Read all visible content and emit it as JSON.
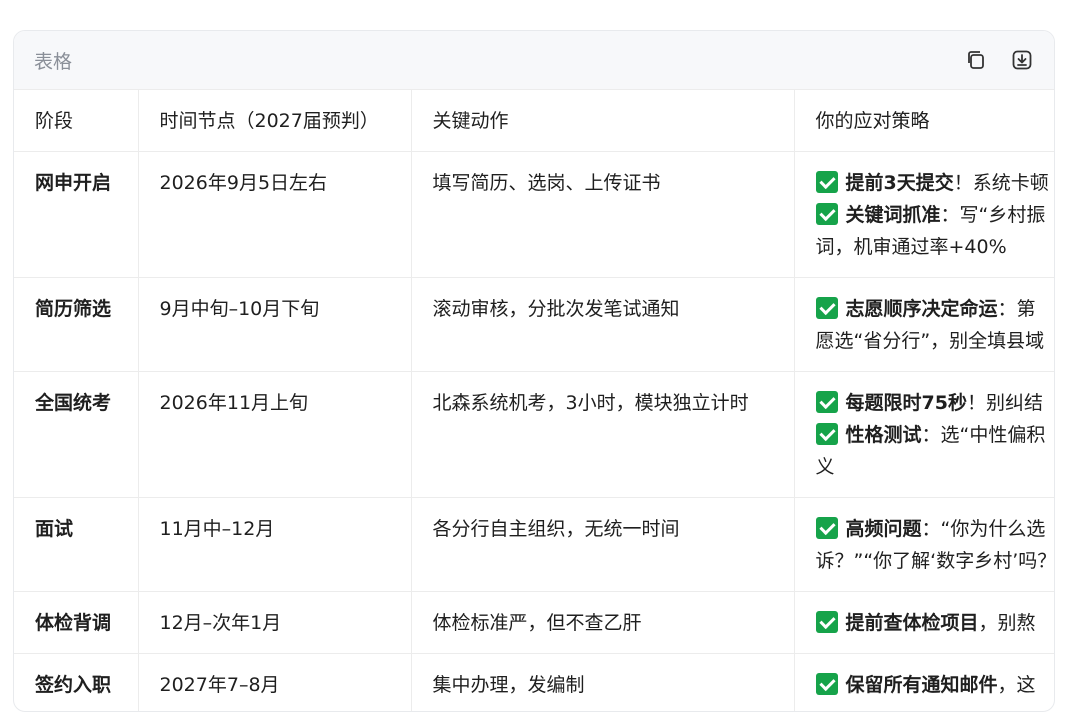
{
  "header": {
    "title": "表格"
  },
  "icons": {
    "copy": "copy-icon",
    "download": "download-icon"
  },
  "columns": [
    "阶段",
    "时间节点（2027届预判）",
    "关键动作",
    "你的应对策略"
  ],
  "rows": [
    {
      "stage": "网申开启",
      "time": "2026年9月5日左右",
      "action": "填写简历、选岗、上传证书",
      "strategy": [
        {
          "check": true,
          "bold": "提前3天提交",
          "rest": "！系统卡顿"
        },
        {
          "check": true,
          "bold": "关键词抓准",
          "rest": "：写“乡村振"
        },
        {
          "check": false,
          "bold": "",
          "rest": "词，机审通过率+40%"
        }
      ]
    },
    {
      "stage": "简历筛选",
      "time": "9月中旬–10月下旬",
      "action": "滚动审核，分批次发笔试通知",
      "strategy": [
        {
          "check": true,
          "bold": "志愿顺序决定命运",
          "rest": "：第"
        },
        {
          "check": false,
          "bold": "",
          "rest": "愿选“省分行”，别全填县域"
        }
      ]
    },
    {
      "stage": "全国统考",
      "time": "2026年11月上旬",
      "action": "北森系统机考，3小时，模块独立计时",
      "strategy": [
        {
          "check": true,
          "bold": "每题限时75秒",
          "rest": "！别纠结"
        },
        {
          "check": true,
          "bold": "性格测试",
          "rest": "：选“中性偏积"
        },
        {
          "check": false,
          "bold": "",
          "rest": "义"
        }
      ]
    },
    {
      "stage": "面试",
      "time": "11月中–12月",
      "action": "各分行自主组织，无统一时间",
      "strategy": [
        {
          "check": true,
          "bold": "高频问题",
          "rest": "：“你为什么选"
        },
        {
          "check": false,
          "bold": "",
          "rest": "诉？”“你了解‘数字乡村’吗？"
        }
      ]
    },
    {
      "stage": "体检背调",
      "time": "12月–次年1月",
      "action": "体检标准严，但不查乙肝",
      "strategy": [
        {
          "check": true,
          "bold": "提前查体检项目",
          "rest": "，别熬"
        }
      ]
    },
    {
      "stage": "签约入职",
      "time": "2027年7–8月",
      "action": "集中办理，发编制",
      "strategy": [
        {
          "check": true,
          "bold": "保留所有通知邮件",
          "rest": "，这"
        }
      ]
    }
  ]
}
